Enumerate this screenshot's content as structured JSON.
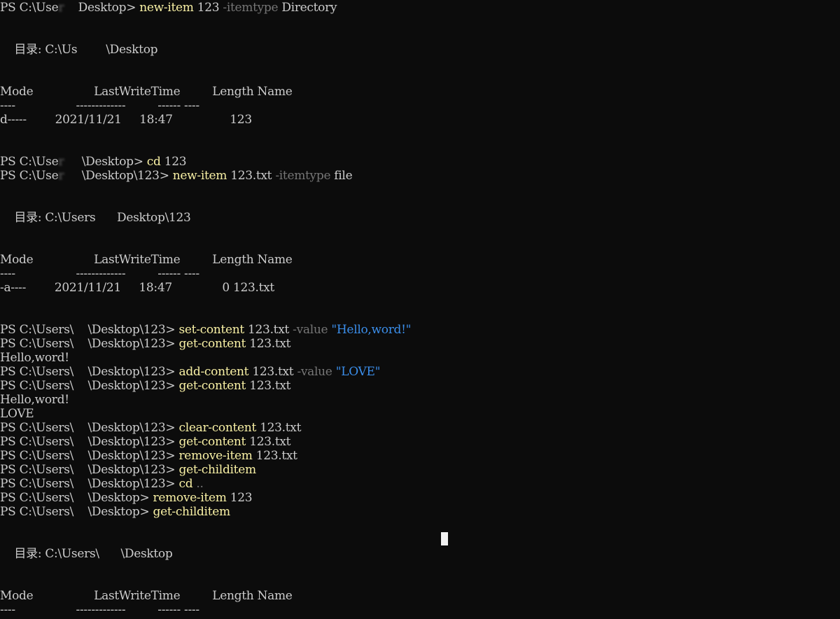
{
  "terminal": {
    "app": "Windows PowerShell",
    "colors": {
      "background": "#0c0c0c",
      "foreground": "#cccccc",
      "command": "#f9f1a5",
      "parameter": "#767676",
      "string": "#3b8eea",
      "cursor": "#f2f2f2"
    },
    "lines": [
      {
        "row": 0,
        "segments": [
          {
            "text": "PS C:\\Use",
            "type": "plain"
          },
          {
            "text": "r    ",
            "type": "blur"
          },
          {
            "text": "Desktop> ",
            "type": "plain"
          },
          {
            "text": "new-item",
            "type": "cmd"
          },
          {
            "text": " 123 ",
            "type": "plain"
          },
          {
            "text": "-itemtype",
            "type": "param"
          },
          {
            "text": " Directory",
            "type": "plain"
          }
        ]
      },
      {
        "row": 3,
        "segments": [
          {
            "text": "    目录: C:\\Us",
            "type": "plain"
          },
          {
            "text": "        ",
            "type": "blur"
          },
          {
            "text": "\\Desktop",
            "type": "plain"
          }
        ]
      },
      {
        "row": 6,
        "segments": [
          {
            "text": "Mode                 LastWriteTime         Length Name",
            "type": "plain"
          }
        ]
      },
      {
        "row": 7,
        "segments": [
          {
            "text": "----                 -------------         ------ ----",
            "type": "plain"
          }
        ]
      },
      {
        "row": 8,
        "segments": [
          {
            "text": "d-----        2021/11/21     18:47                123",
            "type": "plain"
          }
        ]
      },
      {
        "row": 11,
        "segments": [
          {
            "text": "PS C:\\Use",
            "type": "plain"
          },
          {
            "text": "r     ",
            "type": "blur"
          },
          {
            "text": "\\Desktop> ",
            "type": "plain"
          },
          {
            "text": "cd",
            "type": "cmd"
          },
          {
            "text": " 123",
            "type": "plain"
          }
        ]
      },
      {
        "row": 12,
        "segments": [
          {
            "text": "PS C:\\Use",
            "type": "plain"
          },
          {
            "text": "r     ",
            "type": "blur"
          },
          {
            "text": "\\Desktop\\123> ",
            "type": "plain"
          },
          {
            "text": "new-item",
            "type": "cmd"
          },
          {
            "text": " 123.txt ",
            "type": "plain"
          },
          {
            "text": "-itemtype",
            "type": "param"
          },
          {
            "text": " file",
            "type": "plain"
          }
        ]
      },
      {
        "row": 15,
        "segments": [
          {
            "text": "    目录: C:\\Users",
            "type": "plain"
          },
          {
            "text": "      ",
            "type": "blur"
          },
          {
            "text": "Desktop\\123",
            "type": "plain"
          }
        ]
      },
      {
        "row": 18,
        "segments": [
          {
            "text": "Mode                 LastWriteTime         Length Name",
            "type": "plain"
          }
        ]
      },
      {
        "row": 19,
        "segments": [
          {
            "text": "----                 -------------         ------ ----",
            "type": "plain"
          }
        ]
      },
      {
        "row": 20,
        "segments": [
          {
            "text": "-a----        2021/11/21     18:47              0 123.txt",
            "type": "plain"
          }
        ]
      },
      {
        "row": 23,
        "segments": [
          {
            "text": "PS C:\\Users\\",
            "type": "plain"
          },
          {
            "text": "    ",
            "type": "blur"
          },
          {
            "text": "\\Desktop\\123> ",
            "type": "plain"
          },
          {
            "text": "set-content",
            "type": "cmd"
          },
          {
            "text": " 123.txt ",
            "type": "plain"
          },
          {
            "text": "-value",
            "type": "param"
          },
          {
            "text": " ",
            "type": "plain"
          },
          {
            "text": "\"Hello,word!\"",
            "type": "str"
          }
        ]
      },
      {
        "row": 24,
        "segments": [
          {
            "text": "PS C:\\Users\\",
            "type": "plain"
          },
          {
            "text": "    ",
            "type": "blur"
          },
          {
            "text": "\\Desktop\\123> ",
            "type": "plain"
          },
          {
            "text": "get-content",
            "type": "cmd"
          },
          {
            "text": " 123.txt",
            "type": "plain"
          }
        ]
      },
      {
        "row": 25,
        "segments": [
          {
            "text": "Hello,word!",
            "type": "plain"
          }
        ]
      },
      {
        "row": 26,
        "segments": [
          {
            "text": "PS C:\\Users\\",
            "type": "plain"
          },
          {
            "text": "    ",
            "type": "blur"
          },
          {
            "text": "\\Desktop\\123> ",
            "type": "plain"
          },
          {
            "text": "add-content",
            "type": "cmd"
          },
          {
            "text": " 123.txt ",
            "type": "plain"
          },
          {
            "text": "-value",
            "type": "param"
          },
          {
            "text": " ",
            "type": "plain"
          },
          {
            "text": "\"LOVE\"",
            "type": "str"
          }
        ]
      },
      {
        "row": 27,
        "segments": [
          {
            "text": "PS C:\\Users\\",
            "type": "plain"
          },
          {
            "text": "    ",
            "type": "blur"
          },
          {
            "text": "\\Desktop\\123> ",
            "type": "plain"
          },
          {
            "text": "get-content",
            "type": "cmd"
          },
          {
            "text": " 123.txt",
            "type": "plain"
          }
        ]
      },
      {
        "row": 28,
        "segments": [
          {
            "text": "Hello,word!",
            "type": "plain"
          }
        ]
      },
      {
        "row": 29,
        "segments": [
          {
            "text": "LOVE",
            "type": "plain"
          }
        ]
      },
      {
        "row": 30,
        "segments": [
          {
            "text": "PS C:\\Users\\",
            "type": "plain"
          },
          {
            "text": "    ",
            "type": "blur"
          },
          {
            "text": "\\Desktop\\123> ",
            "type": "plain"
          },
          {
            "text": "clear-content",
            "type": "cmd"
          },
          {
            "text": " 123.txt",
            "type": "plain"
          }
        ]
      },
      {
        "row": 31,
        "segments": [
          {
            "text": "PS C:\\Users\\",
            "type": "plain"
          },
          {
            "text": "    ",
            "type": "blur"
          },
          {
            "text": "\\Desktop\\123> ",
            "type": "plain"
          },
          {
            "text": "get-content",
            "type": "cmd"
          },
          {
            "text": " 123.txt",
            "type": "plain"
          }
        ]
      },
      {
        "row": 32,
        "segments": [
          {
            "text": "PS C:\\Users\\",
            "type": "plain"
          },
          {
            "text": "    ",
            "type": "blur"
          },
          {
            "text": "\\Desktop\\123> ",
            "type": "plain"
          },
          {
            "text": "remove-item",
            "type": "cmd"
          },
          {
            "text": " 123.txt",
            "type": "plain"
          }
        ]
      },
      {
        "row": 33,
        "segments": [
          {
            "text": "PS C:\\Users\\",
            "type": "plain"
          },
          {
            "text": "    ",
            "type": "blur"
          },
          {
            "text": "\\Desktop\\123> ",
            "type": "plain"
          },
          {
            "text": "get-childitem",
            "type": "cmd"
          }
        ]
      },
      {
        "row": 34,
        "segments": [
          {
            "text": "PS C:\\Users\\",
            "type": "plain"
          },
          {
            "text": "    ",
            "type": "blur"
          },
          {
            "text": "\\Desktop\\123> ",
            "type": "plain"
          },
          {
            "text": "cd",
            "type": "cmd"
          },
          {
            "text": " ",
            "type": "plain"
          },
          {
            "text": "..",
            "type": "param"
          }
        ]
      },
      {
        "row": 35,
        "segments": [
          {
            "text": "PS C:\\Users\\",
            "type": "plain"
          },
          {
            "text": "    ",
            "type": "blur"
          },
          {
            "text": "\\Desktop> ",
            "type": "plain"
          },
          {
            "text": "remove-item",
            "type": "cmd"
          },
          {
            "text": " 123",
            "type": "plain"
          }
        ]
      },
      {
        "row": 36,
        "segments": [
          {
            "text": "PS C:\\Users\\",
            "type": "plain"
          },
          {
            "text": "    ",
            "type": "blur"
          },
          {
            "text": "\\Desktop> ",
            "type": "plain"
          },
          {
            "text": "get-childitem",
            "type": "cmd"
          }
        ]
      },
      {
        "row": 39,
        "segments": [
          {
            "text": "    目录: C:\\Users\\",
            "type": "plain"
          },
          {
            "text": "      ",
            "type": "blur"
          },
          {
            "text": "\\Desktop",
            "type": "plain"
          }
        ]
      },
      {
        "row": 42,
        "segments": [
          {
            "text": "Mode                 LastWriteTime         Length Name",
            "type": "plain"
          }
        ]
      },
      {
        "row": 43,
        "segments": [
          {
            "text": "----                 -------------         ------ ----",
            "type": "plain"
          }
        ]
      }
    ]
  }
}
